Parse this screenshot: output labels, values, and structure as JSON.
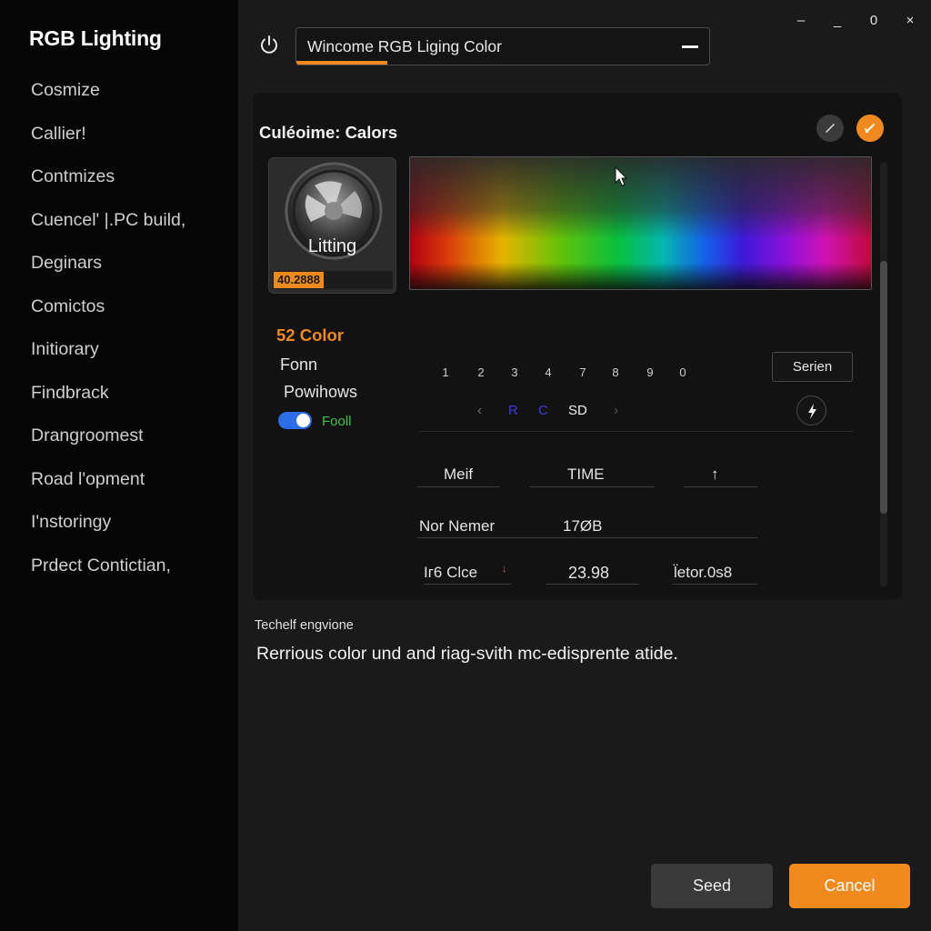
{
  "app": {
    "title": "RGB Lighting"
  },
  "sidebar": {
    "items": [
      {
        "label": "Cosmize"
      },
      {
        "label": "Callier!"
      },
      {
        "label": "Contmizes"
      },
      {
        "label": "Cuencel' |.PC build,"
      },
      {
        "label": "Deginars"
      },
      {
        "label": "Comictos"
      },
      {
        "label": "Initiorary"
      },
      {
        "label": "Findbrack"
      },
      {
        "label": "Drangroomest"
      },
      {
        "label": "Road l'opment"
      },
      {
        "label": "I'nstoringy"
      },
      {
        "label": "Prdect Contictian,"
      }
    ]
  },
  "window_controls": {
    "minimize": "–",
    "restore": "_",
    "maximize": "0",
    "close": "×"
  },
  "header": {
    "search_value": "Wincome RGB Liging Color",
    "power_icon": "power-icon",
    "progress_fraction": 0.22,
    "accent_color": "#f08a1e"
  },
  "panel": {
    "title": "Culéoime: Calors",
    "device": {
      "label": "Litting",
      "badge": "40.2888",
      "icon": "fan-icon"
    },
    "color_count": "52 Color",
    "options": {
      "font": "Fonn",
      "power": "Powihows",
      "toggle_label": "Fooll",
      "toggle_on": true
    },
    "number_scale": [
      "1",
      "2",
      "3",
      "4",
      "7",
      "8",
      "9",
      "0"
    ],
    "modes": {
      "left_arrow": "‹",
      "r": "R",
      "c": "C",
      "sd": "SD",
      "right_arrow": "›"
    },
    "series_button": "Serien",
    "table": {
      "headers": {
        "left": "Meif",
        "mid": "TIME",
        "arrow": "↑"
      },
      "row1": {
        "label": "Nor Nemer",
        "value": "17ØB"
      },
      "row2": {
        "label": "Iг6 Clce",
        "mark": "↓",
        "value": "23.98",
        "extra": "l̈etor.0s8"
      }
    }
  },
  "description": {
    "heading": "Techelf engvione",
    "text": "Rerrious color und and riag-svith mc-edisprente atide."
  },
  "buttons": {
    "seed": "Seed",
    "cancel": "Cancel"
  }
}
